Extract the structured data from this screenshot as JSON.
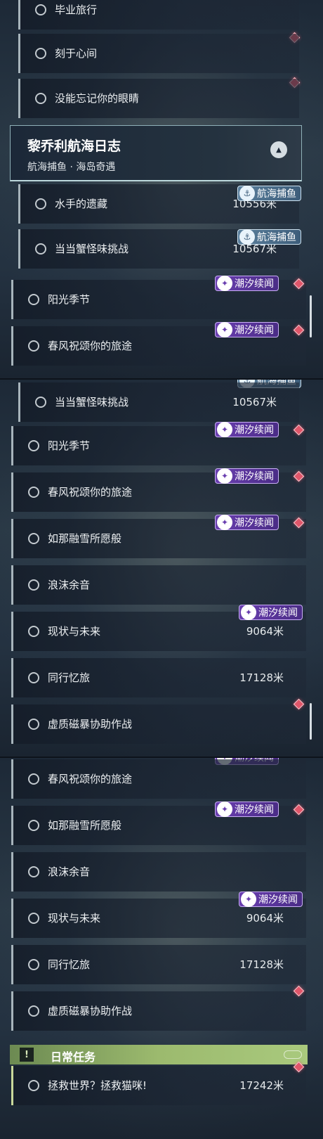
{
  "quests": {
    "graduation_trip": "毕业旅行",
    "etched_in_heart": "刻于心间",
    "unforgettable_eyes": "没能忘记你的眼睛",
    "sailors_legacy": "水手的遗藏",
    "crab_challenge": "当当蟹怪味挑战",
    "sunshine_season": "阳光季节",
    "spring_breeze": "春风祝颂你的旅途",
    "snow_wish": "如那融雪所愿般",
    "foam_echo": "浪沫余音",
    "present_future": "现状与未来",
    "memory_journey": "同行忆旅",
    "magnetic_storm": "虚质磁暴协助作战",
    "save_world_cat": "拯救世界？拯救猫咪!"
  },
  "distances": {
    "sailors_legacy": "10556米",
    "crab_challenge": "10567米",
    "present_future": "9064米",
    "memory_journey": "17128米",
    "save_world_cat": "17242米"
  },
  "group_header": {
    "title": "黎乔利航海日志",
    "subtitle": "航海捕鱼 · 海岛奇遇"
  },
  "badges": {
    "fishing": "航海捕鱼",
    "tide": "潮汐续闻"
  },
  "daily_section": {
    "label": "日常任务",
    "icon_text": "!"
  },
  "colors": {
    "tracker_gem": "#e0566a",
    "tide_badge": "#6a3fb0",
    "fishing_badge": "#5a7f9c",
    "daily_header": "#9cba6e"
  }
}
